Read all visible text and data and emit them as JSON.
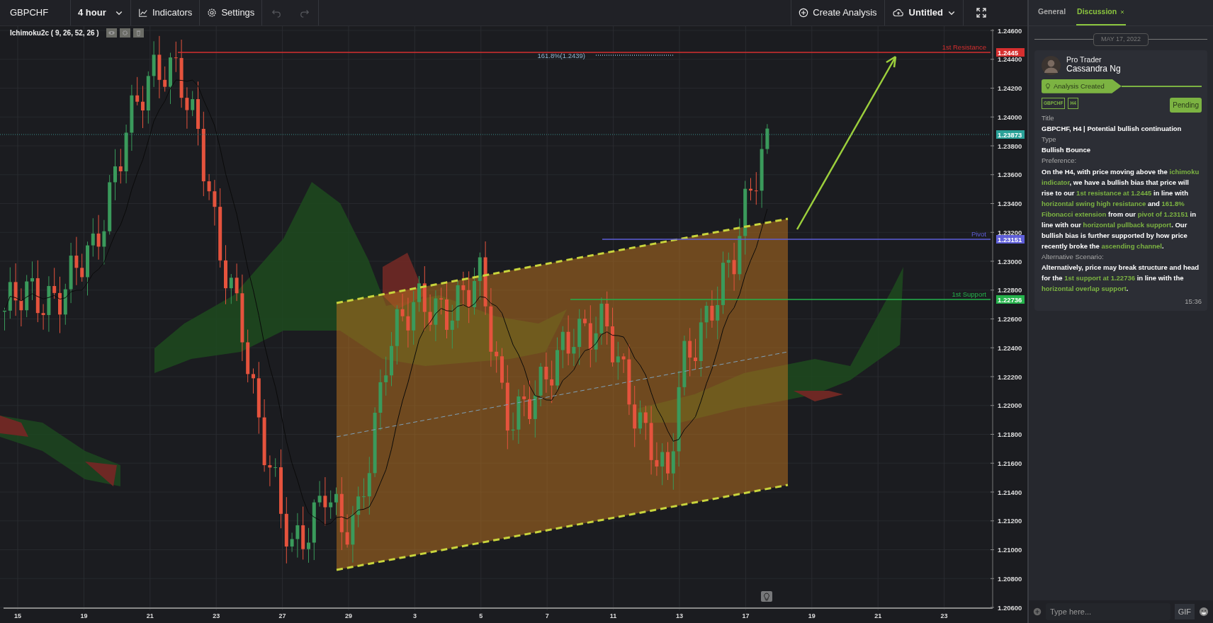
{
  "toolbar": {
    "symbol": "GBPCHF",
    "timeframe": "4 hour",
    "buttons": [
      {
        "kind": "indicators",
        "label": "Indicators"
      },
      {
        "kind": "settings",
        "label": "Settings"
      }
    ],
    "history_buttons": [
      {
        "kind": "undo",
        "disabled": true
      },
      {
        "kind": "redo",
        "disabled": true
      }
    ],
    "create_label": "Create Analysis",
    "file_label": "Untitled"
  },
  "chart": {
    "indicator_legend": "Ichimoku2c ( 9, 26, 52, 26 )",
    "y_ticks": [
      "1.24600",
      "1.24400",
      "1.24200",
      "1.24000",
      "1.23800",
      "1.23600",
      "1.23400",
      "1.23200",
      "1.23000",
      "1.22800",
      "1.22600",
      "1.22400",
      "1.22200",
      "1.22000",
      "1.21800",
      "1.21600",
      "1.21400",
      "1.21200",
      "1.21000",
      "1.20800",
      "1.20600"
    ],
    "x_ticks": [
      "15",
      "19",
      "21",
      "23",
      "27",
      "29",
      "3",
      "5",
      "7",
      "11",
      "13",
      "17",
      "19",
      "21",
      "23"
    ],
    "levels": [
      {
        "label": "1st Resistance",
        "price": "1.2445",
        "color": "#d62f2f"
      },
      {
        "label": "Pivot",
        "price": "1.23151",
        "color": "#5e5ed8"
      },
      {
        "label": "1st Support",
        "price": "1.22736",
        "color": "#25b24b"
      }
    ],
    "current_price": "1.23873",
    "fib_label": "161.8%(1.2439)"
  },
  "panel": {
    "tabs": [
      {
        "label": "General",
        "selected": false,
        "closable": false
      },
      {
        "label": "Discussion",
        "selected": true,
        "closable": true
      }
    ],
    "date": "MAY 17, 2022",
    "post": {
      "role": "Pro Trader",
      "author": "Cassandra Ng",
      "event": "Analysis Created",
      "tags": [
        "GBPCHF",
        "H4"
      ],
      "status": "Pending",
      "fields": [
        {
          "label": "Title",
          "segments": [
            {
              "text": "GBPCHF, H4 | Potential bullish continuation",
              "highlight": false
            }
          ]
        },
        {
          "label": "Type",
          "segments": [
            {
              "text": "Bullish Bounce",
              "highlight": false
            }
          ]
        },
        {
          "label": "Preference:",
          "segments": [
            {
              "text": "On the H4, with price moving above the ",
              "highlight": false
            },
            {
              "text": "ichimoku indicator",
              "highlight": true
            },
            {
              "text": ", we have a bullish bias that price will rise to our ",
              "highlight": false
            },
            {
              "text": "1st resistance at 1.2445",
              "highlight": true
            },
            {
              "text": " in line with ",
              "highlight": false
            },
            {
              "text": "horizontal swing high resistance",
              "highlight": true
            },
            {
              "text": " and ",
              "highlight": false
            },
            {
              "text": "161.8% Fibonacci extension",
              "highlight": true
            },
            {
              "text": " from our ",
              "highlight": false
            },
            {
              "text": "pivot of 1.23151",
              "highlight": true
            },
            {
              "text": " in line with our ",
              "highlight": false
            },
            {
              "text": "horizontal pullback support",
              "highlight": true
            },
            {
              "text": ". Our bullish bias is further supported by how price recently broke the ",
              "highlight": false
            },
            {
              "text": "ascending channel",
              "highlight": true
            },
            {
              "text": ".",
              "highlight": false
            }
          ]
        },
        {
          "label": "Alternative Scenario:",
          "segments": [
            {
              "text": "Alternatively, price may break structure and head for the ",
              "highlight": false
            },
            {
              "text": "1st support at 1.22736",
              "highlight": true
            },
            {
              "text": " in line with the ",
              "highlight": false
            },
            {
              "text": "horizontal overlap support",
              "highlight": true
            },
            {
              "text": ".",
              "highlight": false
            }
          ]
        }
      ],
      "time": "15:36"
    },
    "composer": {
      "placeholder": "Type here...",
      "gif_label": "GIF"
    }
  }
}
